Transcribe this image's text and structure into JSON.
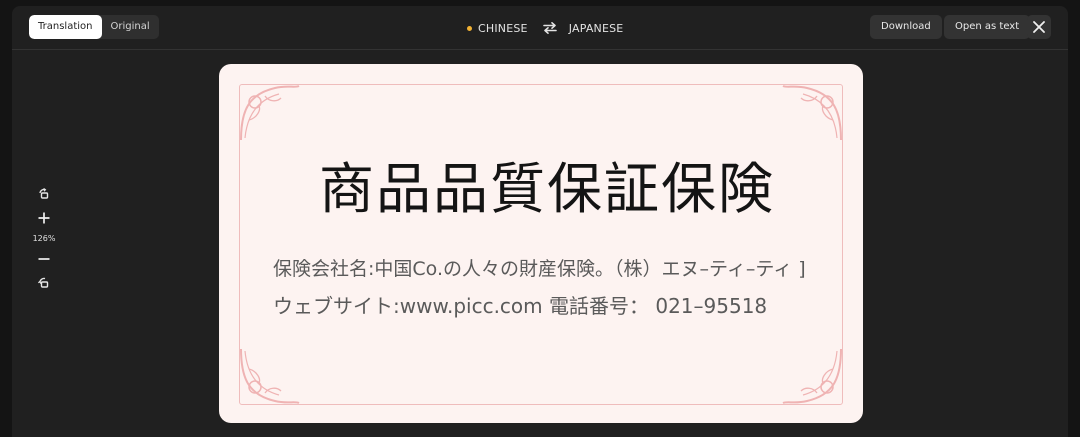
{
  "toolbar": {
    "translation_tab": "Translation",
    "original_tab": "Original",
    "source_lang": "CHINESE",
    "target_lang": "JAPANESE",
    "download_label": "Download",
    "open_as_text_label": "Open as text"
  },
  "zoom": {
    "level": "126%"
  },
  "document": {
    "title": "商品品質保証保険",
    "line1": "保険会社名:中国Co.の人々の財産保険。（株）エヌ–ティ–ティ ]",
    "line2": "ウェブサイト:www.picc.com 電話番号： 021–95518"
  },
  "colors": {
    "accent_dot": "#f2b233",
    "doc_background": "#fdf3f1",
    "ornament": "#efb3b3"
  }
}
